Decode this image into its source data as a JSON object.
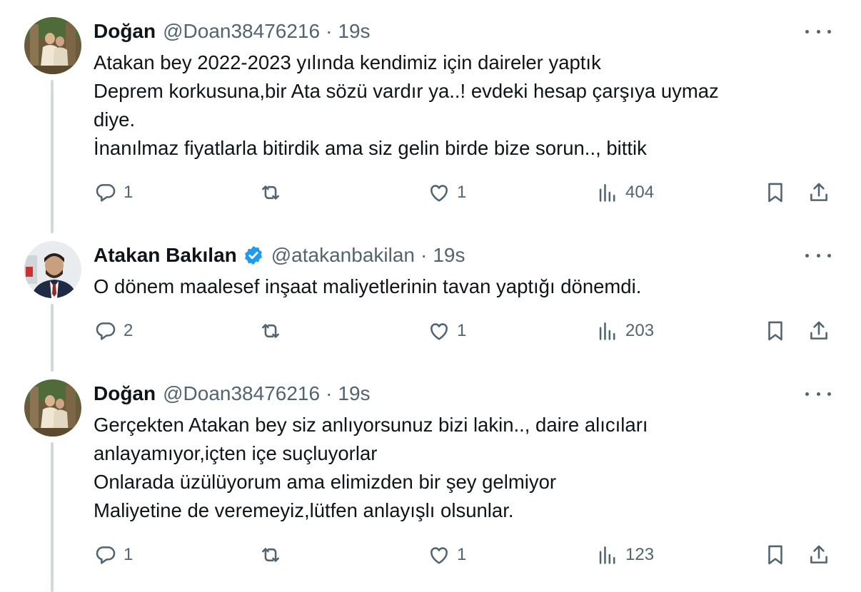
{
  "tweets": [
    {
      "name": "Doğan",
      "handle": "@Doan38476216",
      "time": "19s",
      "verified": false,
      "lines": [
        "Atakan bey 2022-2023 yılında kendimiz için daireler yaptık",
        "Deprem korkusuna,bir Ata sözü vardır ya..! evdeki hesap çarşıya uymaz",
        "diye.",
        "İnanılmaz fiyatlarla bitirdik ama siz gelin birde bize sorun.., bittik"
      ],
      "replies": "1",
      "retweets": "",
      "likes": "1",
      "views": "404"
    },
    {
      "name": "Atakan Bakılan",
      "handle": "@atakanbakilan",
      "time": "19s",
      "verified": true,
      "lines": [
        "O dönem maalesef inşaat maliyetlerinin tavan yaptığı dönemdi."
      ],
      "replies": "2",
      "retweets": "",
      "likes": "1",
      "views": "203"
    },
    {
      "name": "Doğan",
      "handle": "@Doan38476216",
      "time": "19s",
      "verified": false,
      "lines": [
        "Gerçekten Atakan bey siz anlıyorsunuz bizi lakin.., daire alıcıları",
        "anlayamıyor,içten içe suçluyorlar",
        "Onlarada üzülüyorum ama elimizden bir şey gelmiyor",
        "Maliyetine de veremeyiz,lütfen anlayışlı olsunlar."
      ],
      "replies": "1",
      "retweets": "",
      "likes": "1",
      "views": "123"
    }
  ],
  "icons": {
    "reply": "reply-icon",
    "retweet": "retweet-icon",
    "like": "like-icon",
    "views": "views-icon",
    "bookmark": "bookmark-icon",
    "share": "share-icon",
    "more": "more-icon",
    "verified": "verified-badge-icon"
  },
  "colors": {
    "text": "#0f1419",
    "secondary": "#536471",
    "thread_line": "#cfd9de",
    "verified": "#1d9bf0"
  }
}
